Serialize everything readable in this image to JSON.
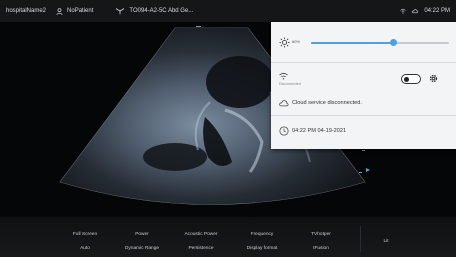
{
  "topbar": {
    "hospital": "hospitalName2",
    "patient": "NoPatient",
    "probe_preset": "TO094-A2-5C Abd Ge...",
    "time": "04:22 PM"
  },
  "quick_settings": {
    "brightness_label": "60%",
    "brightness_level": 0.6,
    "wifi_status": "Disconnected",
    "cloud_status": "Cloud service disconnected.",
    "datetime": "04:22 PM 04-19-2021"
  },
  "controls": {
    "row1": [
      "Full Screen",
      "Power",
      "Acoustic Power",
      "Frequency",
      "TVhotper"
    ],
    "row2": [
      "Auto",
      "Dynamic Range",
      "Persistence",
      "Display format",
      "tFusion"
    ],
    "extra": "Lit"
  },
  "colors": {
    "accent": "#4aa3df",
    "panel_bg": "#f3f4f5",
    "topbar_bg": "#141618"
  }
}
